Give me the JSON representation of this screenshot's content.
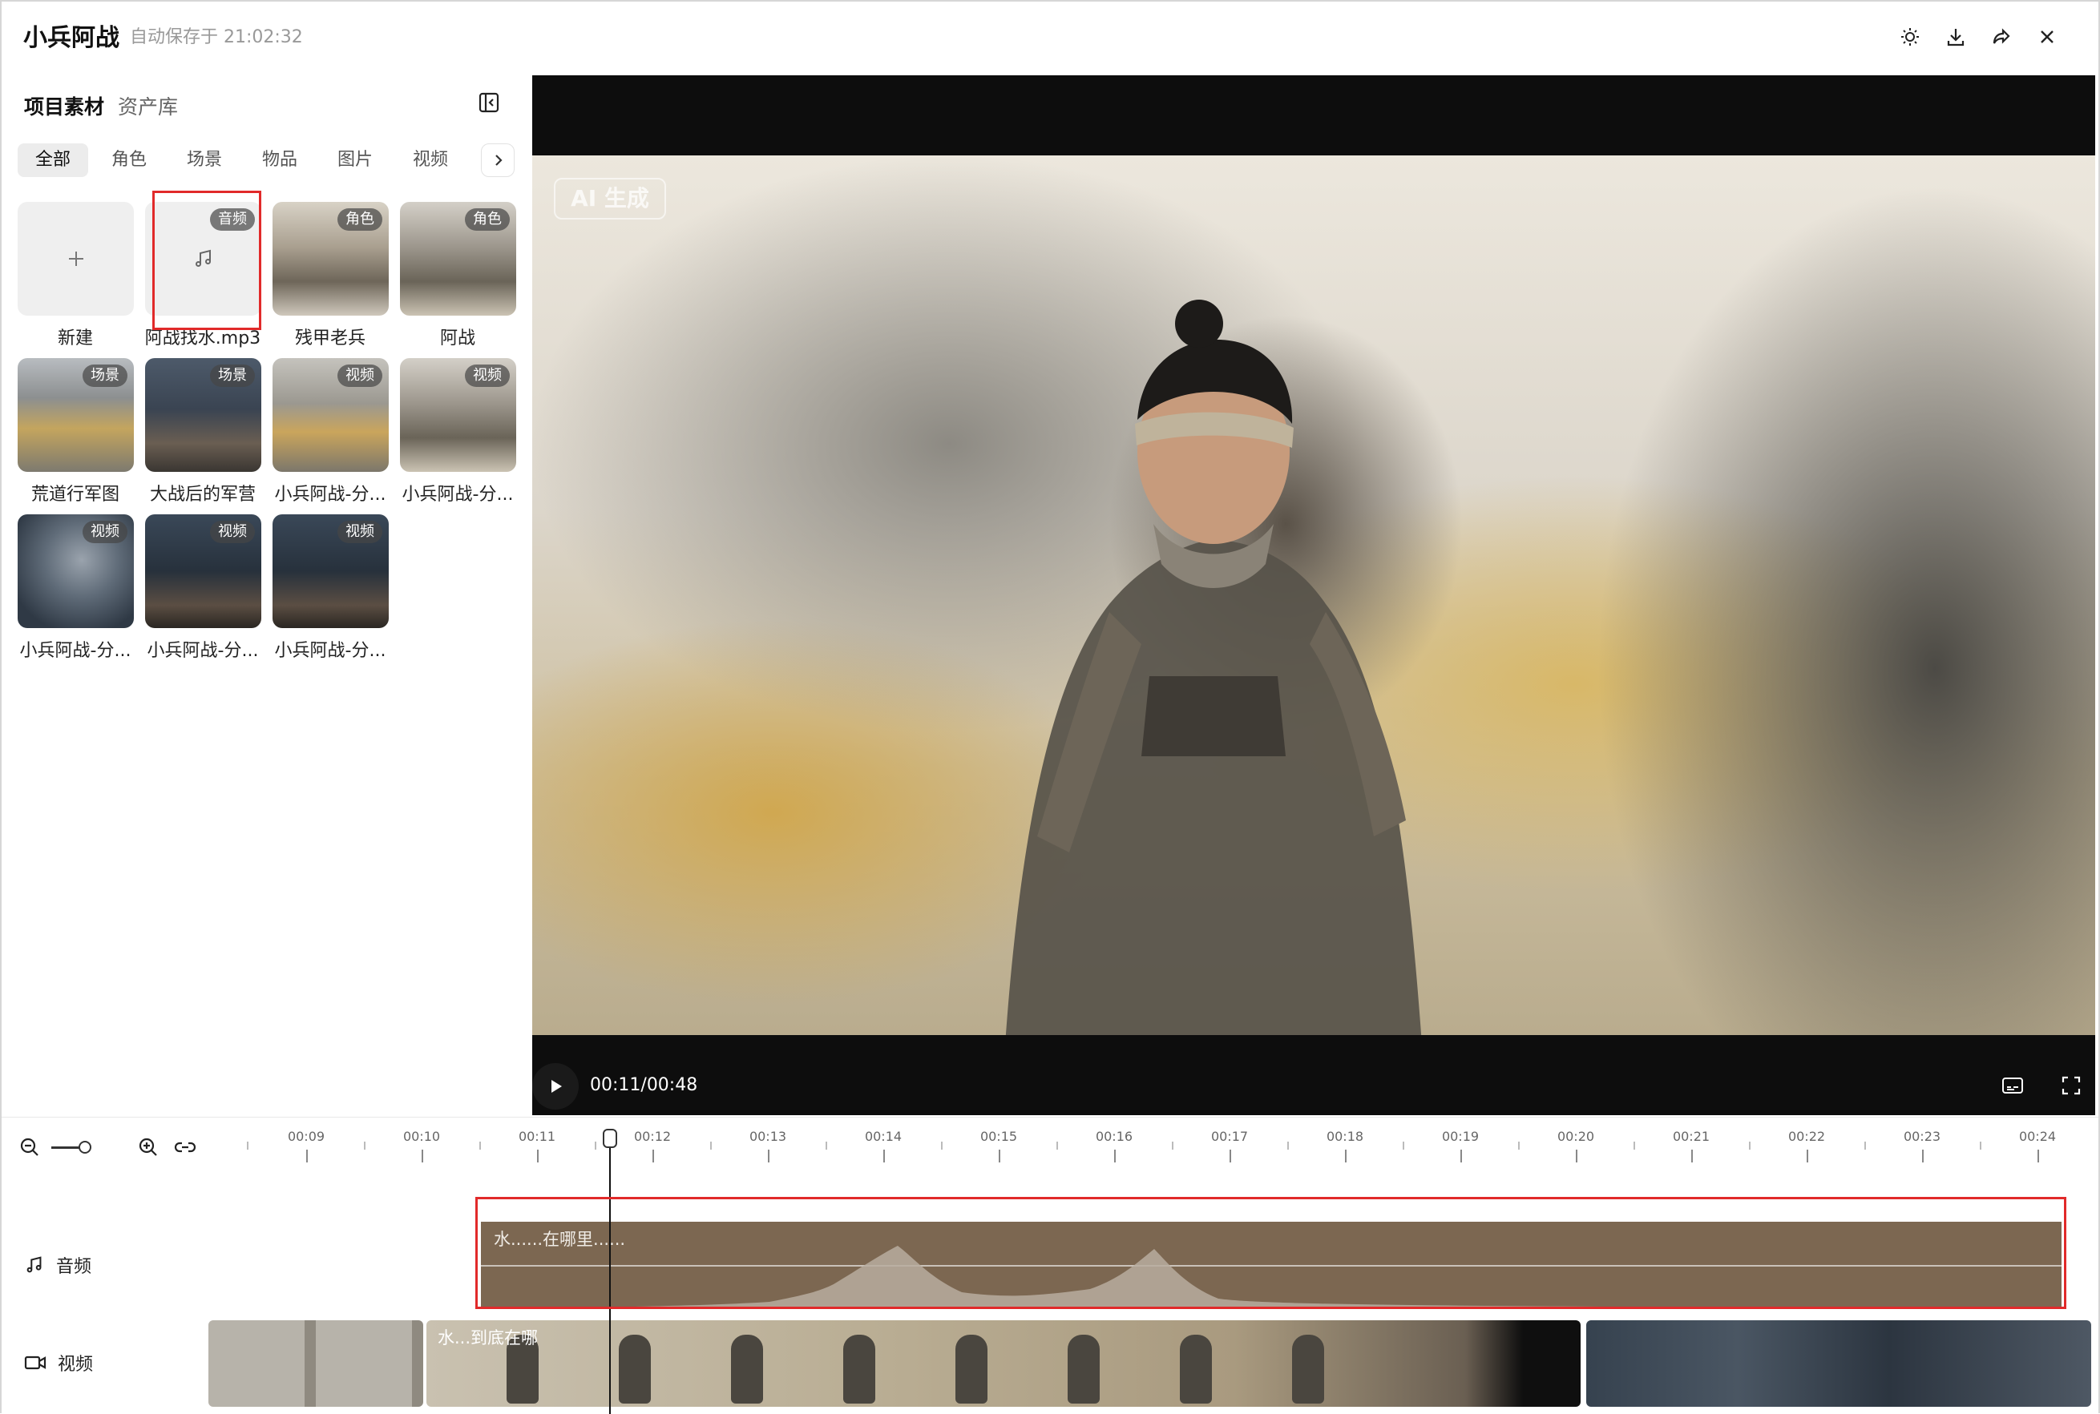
{
  "app": {
    "title": "小兵阿战",
    "autosave": "自动保存于 21:02:32",
    "toolbar_icons": [
      "sun-icon",
      "download-icon",
      "share-icon",
      "close-icon"
    ]
  },
  "sidebar": {
    "tabs": [
      "项目素材",
      "资产库"
    ],
    "filters": [
      "全部",
      "角色",
      "场景",
      "物品",
      "图片",
      "视频"
    ],
    "active_filter": "全部",
    "assets": [
      {
        "caption": "新建",
        "badge": ""
      },
      {
        "caption": "阿战找水.mp3",
        "badge": "音频"
      },
      {
        "caption": "残甲老兵",
        "badge": "角色"
      },
      {
        "caption": "阿战",
        "badge": "角色"
      },
      {
        "caption": "荒道行军图",
        "badge": "场景"
      },
      {
        "caption": "大战后的军营",
        "badge": "场景"
      },
      {
        "caption": "小兵阿战-分...",
        "badge": "视频"
      },
      {
        "caption": "小兵阿战-分...",
        "badge": "视频"
      },
      {
        "caption": "小兵阿战-分...",
        "badge": "视频"
      },
      {
        "caption": "小兵阿战-分...",
        "badge": "视频"
      },
      {
        "caption": "小兵阿战-分...",
        "badge": "视频"
      }
    ]
  },
  "preview": {
    "watermark": "AI 生成",
    "timecode": "00:11/00:48"
  },
  "timeline": {
    "ticks": [
      "00:09",
      "00:10",
      "00:11",
      "00:12",
      "00:13",
      "00:14",
      "00:15",
      "00:16",
      "00:17",
      "00:18",
      "00:19",
      "00:20",
      "00:21",
      "00:22",
      "00:23",
      "00:24"
    ],
    "tracks": {
      "audio": {
        "label": "音频",
        "clip_text": "水......在哪里......"
      },
      "video": {
        "label": "视频",
        "clip_text": "水...到底在哪"
      }
    }
  },
  "colors": {
    "highlight": "#e12a2a",
    "audio_clip": "#7c6751"
  }
}
